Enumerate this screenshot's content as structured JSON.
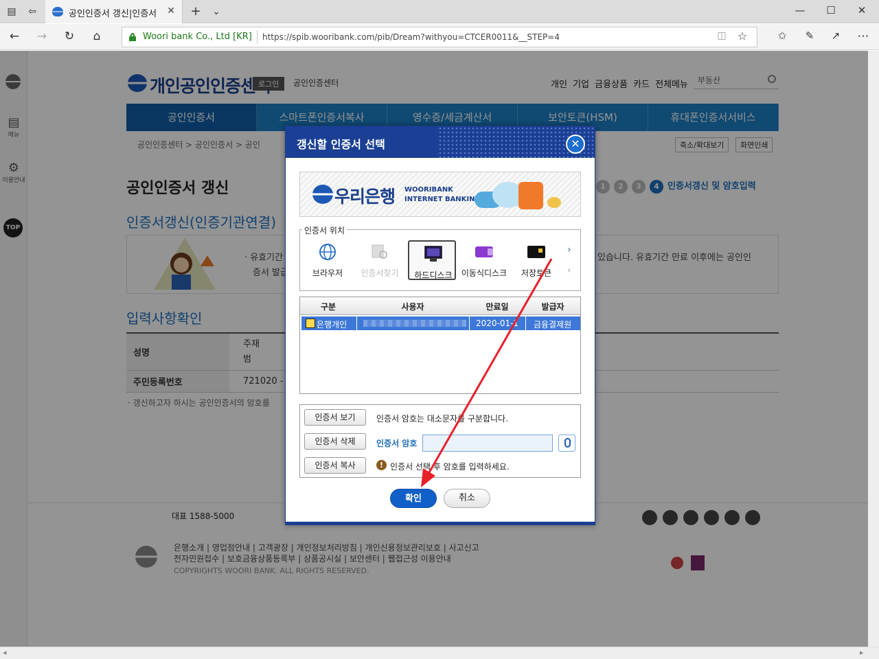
{
  "browser": {
    "tab_title": "공인인증서 갱신|인증서",
    "site_badge": "Woori bank Co., Ltd [KR]",
    "url": "https://spib.wooribank.com/pib/Dream?withyou=CTCER0011&__STEP=4"
  },
  "left_panel": {
    "menu_label": "메뉴",
    "guide_label": "이용안내",
    "top_label": "TOP"
  },
  "header": {
    "logo_text": "개인공인인증센터",
    "login_label": "로그인",
    "center_label": "공인인증센터",
    "top_nav": "개인 기업 금융상품 카드 전체메뉴",
    "search_placeholder": "부동산"
  },
  "gnb": [
    "공인인증서",
    "스마트폰인증서복사",
    "영수증/세금계산서",
    "보안토큰(HSM)",
    "휴대폰인증서서비스"
  ],
  "breadcrumb": "공인인증센터 > 공인인증서 > 공인",
  "zoom_button": "축소/확대보기",
  "print_button": "화면인쇄",
  "page_title": "공인인증서 갱신",
  "steps": {
    "current_number": "4",
    "current_label": "인증서갱신 및 암호입력",
    "dots": [
      "1",
      "2",
      "3"
    ]
  },
  "sub_title": "인증서갱신(인증기관연결)",
  "notice": {
    "line1_start": "· 유효기간",
    "line1_end": "있습니다. 유효기간 만료 이후에는 공인인",
    "line2": "증서 발급"
  },
  "section2_title": "입력사항확인",
  "info_table": {
    "name_label": "성명",
    "name_value1": "주재",
    "name_value2": "범",
    "rrn_label": "주민등록번호",
    "rrn_value": "721020 -"
  },
  "info_note": "· 갱신하고자 하시는 공인인증서의 암호를",
  "footer": {
    "rep_tel": "대표 1588-5000",
    "links1": "은행소개 | 영업점안내 | 고객광장 | 개인정보처리방침 | 개인신용정보관리보호 | 사고신고",
    "links2": "전자민원접수 | 보호금융상품등록부 | 상품공시실 | 보안센터 | 웹접근성 이용안내",
    "copyright": "COPYRIGHTS WOORI BANK. ALL RIGHTS RESERVED."
  },
  "modal": {
    "title": "갱신할 인증서 선택",
    "banner_name": "우리은행",
    "banner_en1": "WOORIBANK",
    "banner_en2": "INTERNET  BANKING",
    "location_legend": "인증서 위치",
    "locations": [
      "브라우저",
      "인증서찾기",
      "하드디스크",
      "이동식디스크",
      "저장토큰"
    ],
    "table_headers": [
      "구분",
      "사용자",
      "만료일",
      "발급자"
    ],
    "cert_row": {
      "type": "은행개인",
      "expiry": "2020-01-1",
      "issuer": "금융결제원"
    },
    "view_button": "인증서 보기",
    "delete_button": "인증서 삭제",
    "copy_button": "인증서 복사",
    "case_message": "인증서 암호는 대소문자를 구분합니다.",
    "password_label": "인증서 암호",
    "warning_message": "인증서 선택 후 암호를 입력하세요.",
    "ok_button": "확인",
    "cancel_button": "취소"
  },
  "colors": {
    "brand_blue": "#1b3f95",
    "gnb_blue": "#1d7ec4",
    "selected_row": "#3d78d8",
    "arrow_red": "#e8202a"
  }
}
